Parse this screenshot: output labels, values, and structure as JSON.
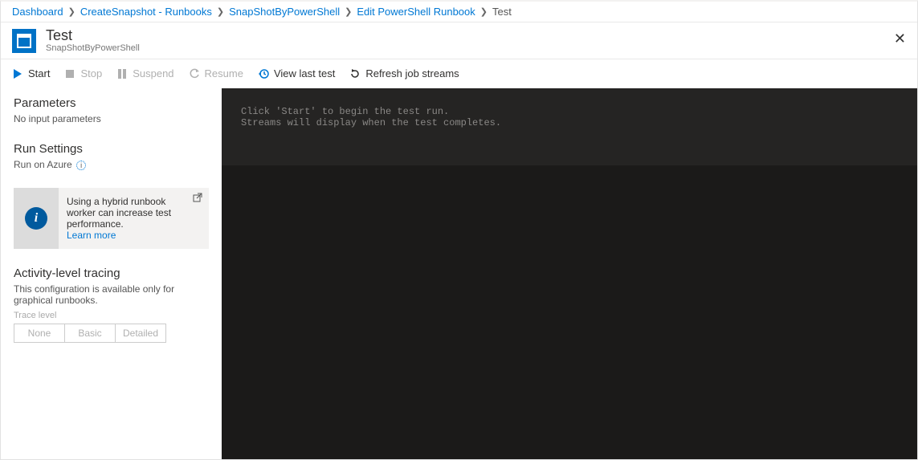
{
  "breadcrumb": {
    "items": [
      {
        "label": "Dashboard"
      },
      {
        "label": "CreateSnapshot - Runbooks"
      },
      {
        "label": "SnapShotByPowerShell"
      },
      {
        "label": "Edit PowerShell Runbook"
      }
    ],
    "current": "Test"
  },
  "header": {
    "title": "Test",
    "subtitle": "SnapShotByPowerShell"
  },
  "toolbar": {
    "start": "Start",
    "stop": "Stop",
    "suspend": "Suspend",
    "resume": "Resume",
    "view_last": "View last test",
    "refresh": "Refresh job streams"
  },
  "sidebar": {
    "parameters": {
      "heading": "Parameters",
      "text": "No input parameters"
    },
    "run_settings": {
      "heading": "Run Settings",
      "run_on_label": "Run on Azure"
    },
    "info_card": {
      "text": "Using a hybrid runbook worker can increase test performance.",
      "link": "Learn more"
    },
    "tracing": {
      "heading": "Activity-level tracing",
      "desc": "This configuration is available only for graphical runbooks.",
      "label": "Trace level",
      "options": [
        "None",
        "Basic",
        "Detailed"
      ]
    }
  },
  "console": {
    "line1": "Click 'Start' to begin the test run.",
    "line2": "Streams will display when the test completes."
  }
}
